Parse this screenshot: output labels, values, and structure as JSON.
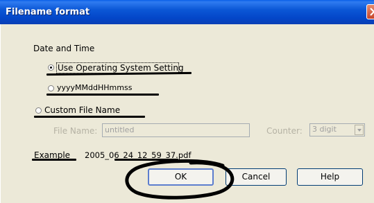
{
  "dialog": {
    "title": "Filename format"
  },
  "date_time": {
    "label": "Date and Time",
    "os_setting": {
      "label": "Use Operating System Setting",
      "selected": true
    },
    "pattern": {
      "label": "yyyyMMddHHmmss",
      "selected": false
    }
  },
  "custom": {
    "label": "Custom File Name",
    "selected": false,
    "file_name_label": "File Name:",
    "file_name_value": "untitled",
    "counter_label": "Counter:",
    "counter_value": "3 digit"
  },
  "example": {
    "label": "Example",
    "value": "2005_06_24_12_59_37.pdf"
  },
  "buttons": {
    "ok": "OK",
    "cancel": "Cancel",
    "help": "Help"
  },
  "colors": {
    "titlebar": "#0A53D8",
    "dialog_bg": "#ECE9D8",
    "annotation_ink": "#000000"
  }
}
